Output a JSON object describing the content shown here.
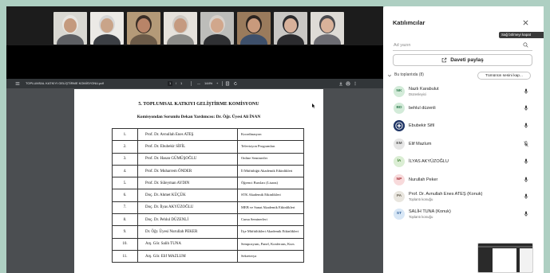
{
  "video_tiles": [
    {
      "bg": "#d9d8d2",
      "skin": "#c49a7e",
      "hair": "#e8e6e2",
      "shirt": "#5d5f63"
    },
    {
      "bg": "#eceae6",
      "skin": "#c9a489",
      "hair": "#d6d6d6",
      "shirt": "#3c3f44"
    },
    {
      "bg": "#b49a78",
      "skin": "#b88468",
      "hair": "#3a2e26",
      "shirt": "#6b5a48"
    },
    {
      "bg": "#e6e2dc",
      "skin": "#c59a80",
      "hair": "#cfcac4",
      "shirt": "#8b8b88"
    },
    {
      "bg": "#bdbdba",
      "skin": "#d1a78c",
      "hair": "#d8d1cb",
      "shirt": "#2f3033"
    },
    {
      "bg": "#9a7b5c",
      "skin": "#c99a7c",
      "hair": "#2b2420",
      "shirt": "#3d4f6a"
    },
    {
      "bg": "#c9c7c4",
      "skin": "#d8b19a",
      "hair": "#2b2b2e",
      "shirt": "#2b2b2e"
    },
    {
      "bg": "#dedbd6",
      "skin": "#d9b29a",
      "hair": "#4a4a4e",
      "shirt": "#6c6c72"
    }
  ],
  "pdf_viewer": {
    "file_name": "TOPLUMSAL KATKIYI GELİŞTİRME KOMİSYONU.pdf",
    "page_current": "1",
    "page_separator": "/",
    "page_total": "1",
    "zoom_out": "—",
    "zoom": "144%",
    "zoom_in": "+",
    "icons": [
      "menu-icon",
      "fit-page-icon",
      "rotate-icon",
      "download-icon",
      "print-icon",
      "more-icon"
    ]
  },
  "document": {
    "title": "5. TOPLUMSAL KATKIYI GELİŞTİRME KOMİSYONU",
    "subtitle": "Komisyondan Sorumlu Dekan Yardımcısı: Dr. Öğr. Üyesi Ali İNAN",
    "rows": [
      {
        "no": "1.",
        "name": "Prof. Dr. Avnullah Enes ATEŞ",
        "duty": "Koordinasyon"
      },
      {
        "no": "2.",
        "name": "Prof. Dr. Ebubekir SİFİL",
        "duty": "Televizyon Programları"
      },
      {
        "no": "3.",
        "name": "Prof. Dr. Hasan GÜMÜŞOĞLU",
        "duty": "Online Seminerler"
      },
      {
        "no": "4.",
        "name": "Prof. Dr. Muharrem ÖNDER",
        "duty": "İl Müftülüğü Akademik Etkinlikleri"
      },
      {
        "no": "5.",
        "name": "Prof. Dr. Süleyman AYDIN",
        "duty": "Öğrenci Bursları (Lisans)"
      },
      {
        "no": "6.",
        "name": "Doç. Dr. Ahmet KÜÇÜK",
        "duty": "STK Akademik Etkinlikleri"
      },
      {
        "no": "7.",
        "name": "Doç. Dr. İlyas AKYÜZOĞLU",
        "duty": "MEB ve Sanat Akademik Etkinlikleri"
      },
      {
        "no": "8.",
        "name": "Doç. Dr. Pehlul DÜZENLİ",
        "duty": "Cuma Seminerleri"
      },
      {
        "no": "9.",
        "name": "Dr. Öğr. Üyesi Nurullah PEKER",
        "duty": "İlçe Müftülükleri Akademik Etkinlikleri"
      },
      {
        "no": "10.",
        "name": "Arş. Gör. Salih TUNA",
        "duty": "Sempozyum, Panel, Konferans, Kurs"
      },
      {
        "no": "11.",
        "name": "Arş. Gör. Elif MAZLUM",
        "duty": "Sekreterya"
      }
    ]
  },
  "participants_panel": {
    "title": "Katılımcılar",
    "close_tooltip": "Sağ bölmeyi kapat",
    "search_placeholder": "Ad yazın",
    "share_invite_label": "Daveti paylaş",
    "section_label": "Bu toplantıda (8)",
    "mute_all_label": "Tümünün sesini kap...",
    "participants": [
      {
        "initials": "NK",
        "name": "Nazlı Karabulut",
        "subtitle": "Düzenleyici",
        "avatar_bg": "#d3ebd9",
        "avatar_fg": "#2e7a4e",
        "mic_icon": "microphone-icon"
      },
      {
        "initials": "BD",
        "name": "behlul düzenli",
        "avatar_bg": "#d3ebd9",
        "avatar_fg": "#2e7a4e",
        "mic_icon": "microphone-icon"
      },
      {
        "name": "Ebubekir Sifil",
        "avatar_bg": "#1f3566",
        "avatar_fg": "#ffffff",
        "avatar_icon": "emblem-photo-icon",
        "mic_icon": "microphone-icon"
      },
      {
        "initials": "EM",
        "name": "Elif Mazlum",
        "avatar_bg": "#e6e6e6",
        "avatar_fg": "#555555",
        "mic_icon": "microphone-off-icon"
      },
      {
        "initials": "İA",
        "name": "İLYAS AKYÜZOĞLU",
        "avatar_bg": "#dbeed4",
        "avatar_fg": "#3c7a2e",
        "mic_icon": "microphone-icon"
      },
      {
        "initials": "NP",
        "name": "Nurullah Peker",
        "avatar_bg": "#f8dadb",
        "avatar_fg": "#a8323b",
        "mic_icon": "microphone-icon"
      },
      {
        "initials": "PA",
        "name": "Prof. Dr. Avnullah Enes ATEŞ (Konuk)",
        "subtitle": "Toplantı konuğu",
        "avatar_bg": "#e9e6df",
        "avatar_fg": "#6b6457",
        "mic_icon": "microphone-icon"
      },
      {
        "initials": "ST",
        "name": "SALİH TUNA (Konuk)",
        "subtitle": "Toplantı konuğu",
        "avatar_bg": "#d8e7f6",
        "avatar_fg": "#2e5f9a",
        "mic_icon": "microphone-icon"
      }
    ]
  }
}
